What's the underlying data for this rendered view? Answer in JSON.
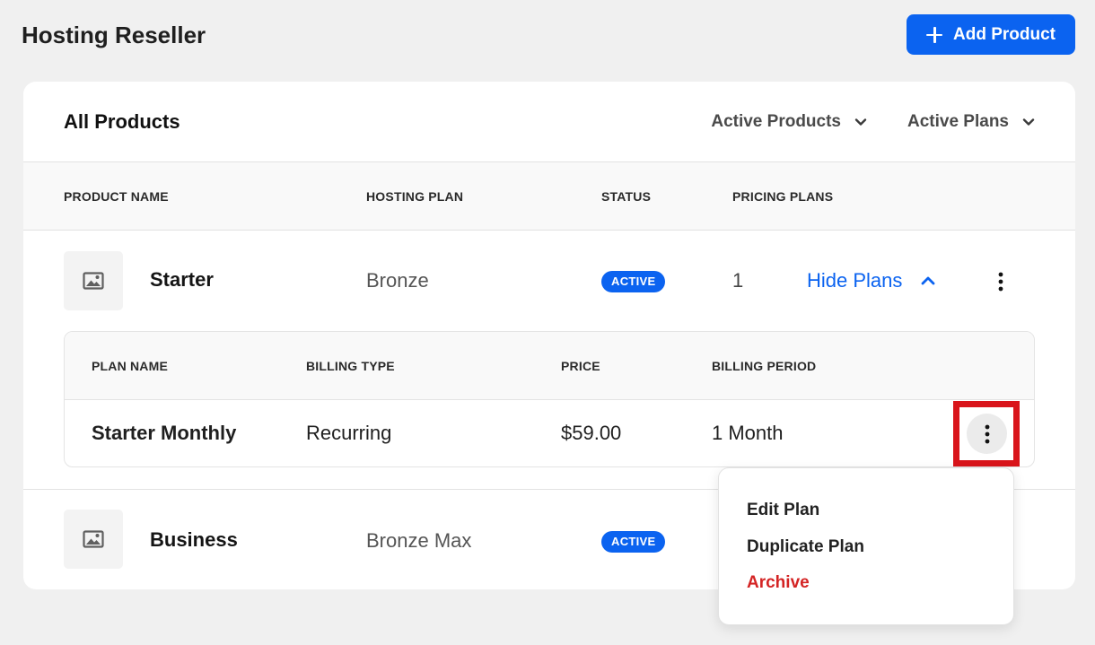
{
  "header": {
    "title": "Hosting Reseller",
    "add_button_label": "Add Product"
  },
  "card": {
    "title": "All Products",
    "filters": [
      {
        "label": "Active Products"
      },
      {
        "label": "Active Plans"
      }
    ],
    "columns": [
      "PRODUCT NAME",
      "HOSTING PLAN",
      "STATUS",
      "PRICING PLANS"
    ]
  },
  "products": [
    {
      "name": "Starter",
      "hosting_plan": "Bronze",
      "status": "ACTIVE",
      "pricing_plans": "1",
      "toggle_label": "Hide Plans"
    },
    {
      "name": "Business",
      "hosting_plan": "Bronze Max",
      "status": "ACTIVE"
    }
  ],
  "plans_table": {
    "columns": [
      "PLAN NAME",
      "BILLING TYPE",
      "PRICE",
      "BILLING PERIOD"
    ],
    "rows": [
      {
        "plan_name": "Starter Monthly",
        "billing_type": "Recurring",
        "price": "$59.00",
        "billing_period": "1 Month"
      }
    ]
  },
  "context_menu": {
    "items": [
      {
        "label": "Edit Plan"
      },
      {
        "label": "Duplicate Plan"
      },
      {
        "label": "Archive"
      }
    ]
  },
  "colors": {
    "accent": "#0b63f0",
    "danger": "#d42424",
    "highlight": "#d9151b",
    "background": "#f0f0f0"
  },
  "icons": {
    "add": "plus-icon",
    "filter": "chevron-down-icon",
    "hide": "chevron-up-icon",
    "thumbnail": "image-icon",
    "more": "vertical-ellipsis-icon"
  }
}
